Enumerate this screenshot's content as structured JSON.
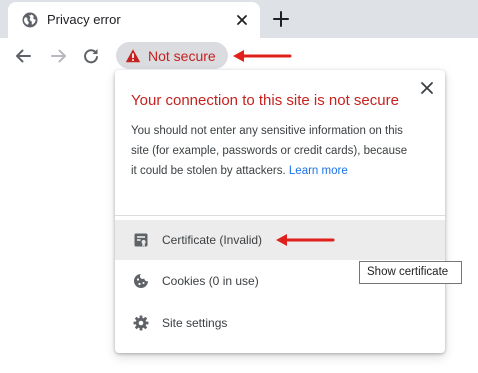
{
  "tab": {
    "title": "Privacy error",
    "favicon": "globe-icon",
    "close_icon": "close-icon",
    "new_tab_icon": "plus-icon"
  },
  "toolbar": {
    "back_icon": "arrow-back-icon",
    "forward_icon": "arrow-forward-icon",
    "reload_icon": "reload-icon",
    "security_chip": {
      "icon": "warning-triangle-icon",
      "label": "Not secure"
    }
  },
  "popup": {
    "title": "Your connection to this site is not secure",
    "body_lines": [
      "You should not enter any sensitive information on this",
      "site (for example, passwords or credit cards), because",
      "it could be stolen by attackers."
    ],
    "learn_more": "Learn more",
    "items": [
      {
        "icon": "certificate-icon",
        "label": "Certificate (Invalid)"
      },
      {
        "icon": "cookie-icon",
        "label": "Cookies (0 in use)"
      },
      {
        "icon": "gear-icon",
        "label": "Site settings"
      }
    ]
  },
  "tooltip": {
    "text": "Show certificate"
  },
  "annotations": {
    "arrow_color": "#e0201b"
  },
  "colors": {
    "warning": "#c5221f",
    "link": "#1a73e8",
    "tabstrip": "#dee1e6",
    "chip": "#dadce0"
  }
}
